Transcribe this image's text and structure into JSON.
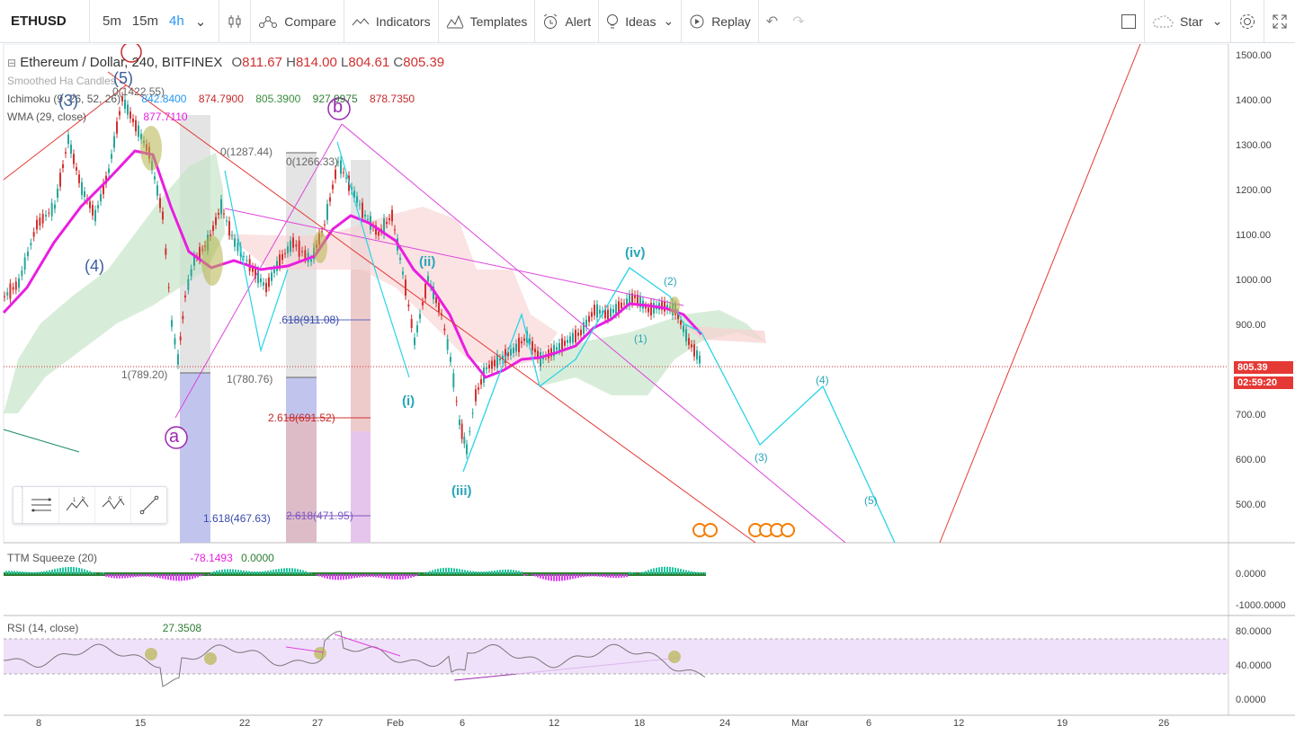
{
  "toolbar": {
    "symbol": "ETHUSD",
    "intervals": [
      "5m",
      "15m",
      "4h"
    ],
    "compare": "Compare",
    "indicators": "Indicators",
    "templates": "Templates",
    "alert": "Alert",
    "ideas": "Ideas",
    "replay": "Replay",
    "star": "Star"
  },
  "legend": {
    "title": "Ethereum / Dollar, 240, BITFINEX",
    "o_label": "O",
    "o": "811.67",
    "h_label": "H",
    "h": "814.00",
    "l_label": "L",
    "l": "804.61",
    "c_label": "C",
    "c": "805.39",
    "ha": "Smoothed Ha Candles",
    "ichimoku_label": "Ichimoku (9, 26, 52, 26)",
    "ichimoku_values": [
      "842.8400",
      "874.7900",
      "805.3900",
      "927.9975",
      "878.7350"
    ],
    "wma_label": "WMA (29, close)",
    "wma_value": "877.7110"
  },
  "price_axis": [
    "1500.00",
    "1400.00",
    "1300.00",
    "1200.00",
    "1100.00",
    "1000.00",
    "900.00",
    "800.00",
    "700.00",
    "600.00",
    "500.00"
  ],
  "last_price": "805.39",
  "countdown": "02:59:20",
  "ttm": {
    "label": "TTM Squeeze (20)",
    "v1": "-78.1493",
    "v2": "0.0000",
    "axis": [
      "0.0000",
      "-1000.0000"
    ]
  },
  "rsi": {
    "label": "RSI (14, close)",
    "value": "27.3508",
    "axis": [
      "80.0000",
      "40.0000",
      "0.0000"
    ]
  },
  "date_axis": [
    "8",
    "15",
    "22",
    "27",
    "Feb",
    "6",
    "12",
    "18",
    "24",
    "Mar",
    "6",
    "12",
    "19",
    "26"
  ],
  "fib_labels": [
    "0(1422.55)",
    "0(1287.44)",
    "0(1266.33)",
    "1(789.20)",
    "1(780.76)",
    ".618(911.08)",
    "2.618(691.52)",
    "1.618(467.63)",
    "2.618(471.95)"
  ],
  "wave_labels": {
    "a": "a",
    "b": "b",
    "w3": "(3)",
    "w4": "(4)",
    "w5": "(5)",
    "ii": "(ii)",
    "iii": "(iii)",
    "iv": "(iv)",
    "i": "(i)",
    "f1": "(1)",
    "f2": "(2)",
    "f3": "(3)",
    "f4": "(4)",
    "f5": "(5)"
  },
  "colors": {
    "up": "#26a69a",
    "down": "#d32f2f",
    "wma": "#e91ee0",
    "cyan": "#27d4e8",
    "magenta": "#dd44dd",
    "redline": "#e53935"
  }
}
